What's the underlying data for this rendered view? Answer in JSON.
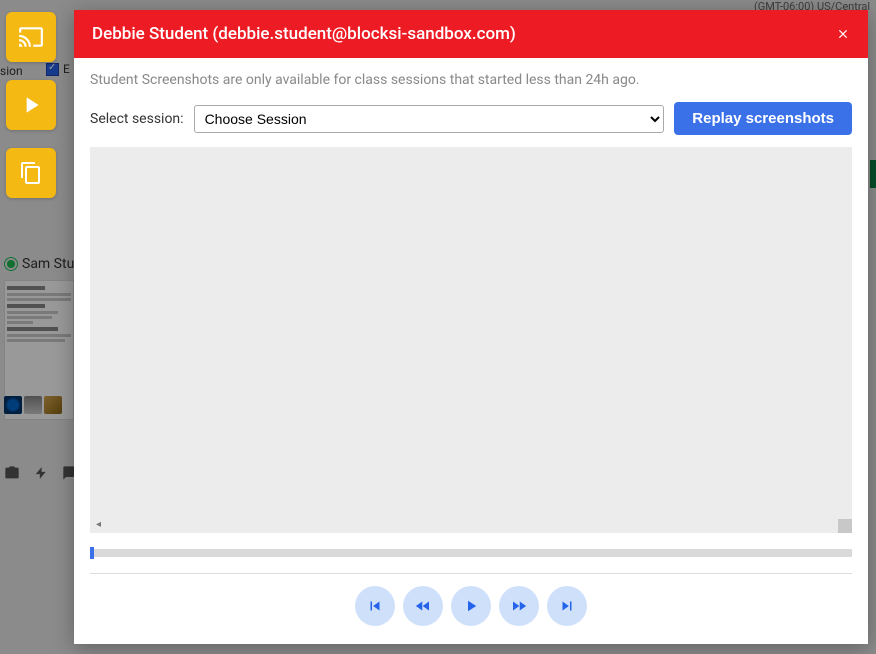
{
  "modal": {
    "title": "Debbie Student (debbie.student@blocksi-sandbox.com)",
    "info_text": "Student Screenshots are only available for class sessions that started less than 24h ago.",
    "session_label": "Select session:",
    "session_select_placeholder": "Choose Session",
    "replay_button_label": "Replay screenshots"
  },
  "background": {
    "truncated_sion": "sion",
    "checkbox_label": "E",
    "student_tile_name": "Sam Stu",
    "gmt_text": "(GMT-06:00) US/Central"
  },
  "icons": {
    "cast": "cast-icon",
    "play": "play-icon",
    "copy": "copy-icon",
    "camera": "camera-icon",
    "bolt": "bolt-icon",
    "chat": "chat-icon",
    "close": "close-icon",
    "skip_first": "skip-first-icon",
    "rewind": "rewind-icon",
    "play_center": "play-center-icon",
    "forward": "forward-icon",
    "skip_last": "skip-last-icon"
  },
  "colors": {
    "yellow": "#f5b914",
    "red": "#ed1c24",
    "blue": "#3b71e8",
    "light_blue": "#cfe0fa",
    "gray_bg": "#ececec"
  }
}
